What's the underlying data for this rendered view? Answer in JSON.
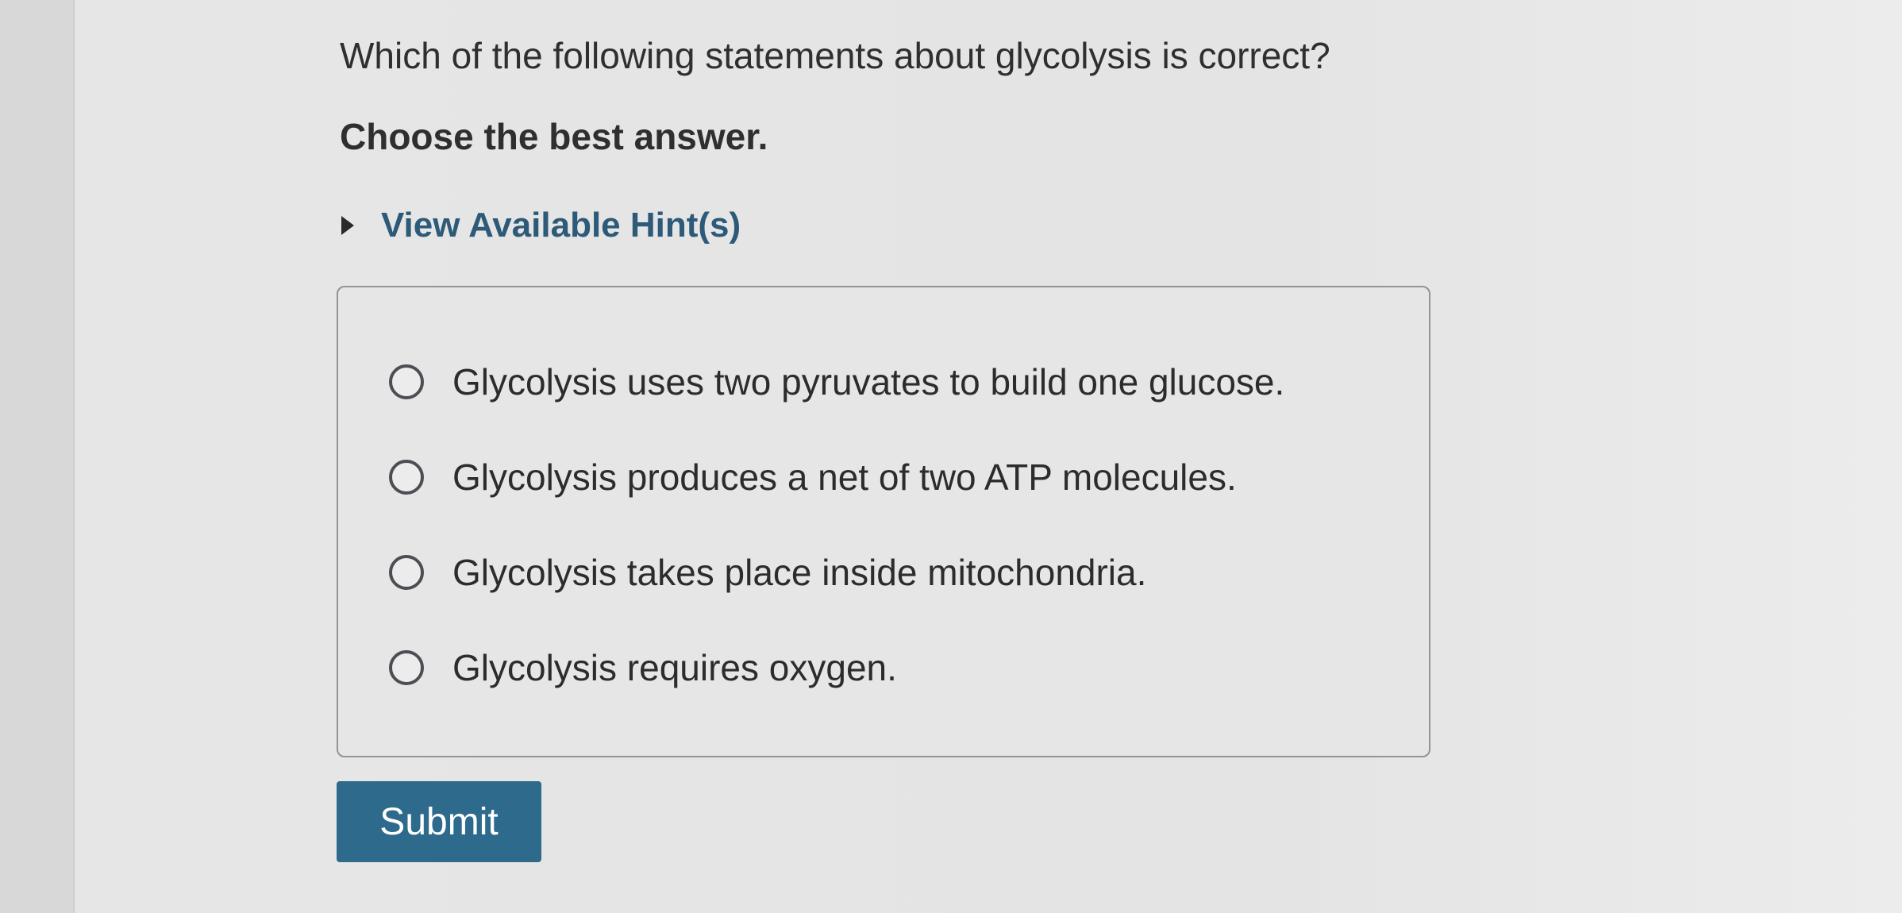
{
  "question": {
    "text": "Which of the following statements about glycolysis is correct?",
    "instruction": "Choose the best answer."
  },
  "hint": {
    "label": "View Available Hint(s)",
    "expanded": false
  },
  "choices": [
    {
      "label": "Glycolysis uses two pyruvates to build one glucose.",
      "selected": false
    },
    {
      "label": "Glycolysis produces a net of two ATP molecules.",
      "selected": false
    },
    {
      "label": "Glycolysis takes place inside mitochondria.",
      "selected": false
    },
    {
      "label": "Glycolysis requires oxygen.",
      "selected": false
    }
  ],
  "submit": {
    "label": "Submit"
  },
  "colors": {
    "accent": "#2d6a8c",
    "hint_text": "#2c5a78",
    "page_background": "#e4e4e4"
  }
}
